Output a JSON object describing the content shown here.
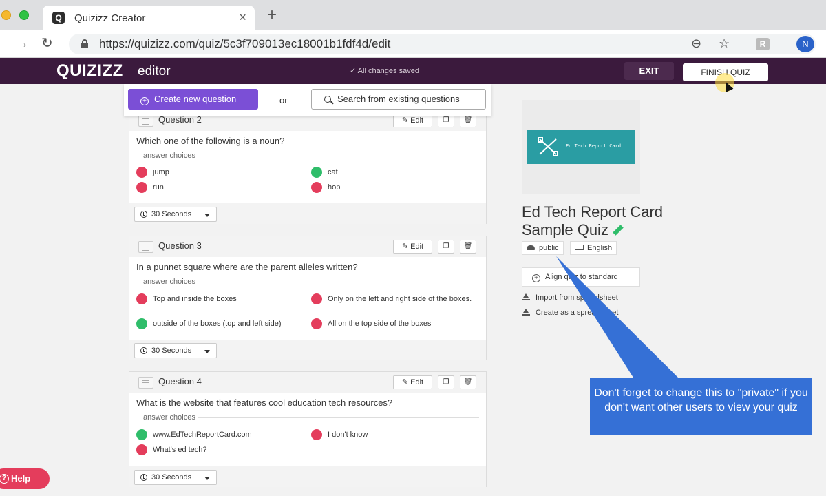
{
  "browser": {
    "tab_title": "Quizizz Creator",
    "tab_close": "×",
    "new_tab": "+",
    "url": "https://quizizz.com/quiz/5c3f709013ec18001b1fdf4d/edit",
    "back_glyph": "→",
    "reload_glyph": "↻",
    "zoom_glyph": "⊖",
    "star_glyph": "☆",
    "extension_label": "R",
    "avatar_initial": "N",
    "favicon_letter": "Q"
  },
  "header": {
    "logo": "QUIZIZZ",
    "logo_sub": "editor",
    "save_status": "✓ All changes saved",
    "exit_label": "EXIT",
    "finish_label": "FINISH QUIZ",
    "bg_color": "#3b1a3d"
  },
  "create_bar": {
    "create_label": "Create new question",
    "or_text": "or",
    "search_label": "Search from existing questions",
    "accent_color": "#7b4fd6"
  },
  "questions": [
    {
      "label": "Question 2",
      "text": "Which one of the following is a noun?",
      "answer_label": "answer choices",
      "choices": [
        {
          "text": "jump",
          "correct": false
        },
        {
          "text": "cat",
          "correct": true
        },
        {
          "text": "run",
          "correct": false
        },
        {
          "text": "hop",
          "correct": false
        }
      ],
      "time": "30 Seconds",
      "edit_label": "Edit"
    },
    {
      "label": "Question 3",
      "text": "In a punnet square where are the parent alleles written?",
      "answer_label": "answer choices",
      "choices": [
        {
          "text": "Top and inside the boxes",
          "correct": false
        },
        {
          "text": "Only on the left and right side of the boxes.",
          "correct": false
        },
        {
          "text": "outside of the boxes (top and left side)",
          "correct": true
        },
        {
          "text": "All on the top side of the boxes",
          "correct": false
        }
      ],
      "time": "30 Seconds",
      "edit_label": "Edit"
    },
    {
      "label": "Question 4",
      "text": "What is the website that features cool education tech resources?",
      "answer_label": "answer choices",
      "choices": [
        {
          "text": "www.EdTechReportCard.com",
          "correct": true
        },
        {
          "text": "I don't know",
          "correct": false
        },
        {
          "text": "What's ed tech?",
          "correct": false
        }
      ],
      "time": "30 Seconds",
      "edit_label": "Edit"
    }
  ],
  "quiz_info": {
    "thumbnail_text": "Ed Tech Report Card",
    "title": "Ed Tech Report Card Sample Quiz",
    "visibility": "public",
    "language": "English",
    "align_label": "Align quiz to standard",
    "import_label": "Import from spreadsheet",
    "create_sheet_label": "Create as a spreadsheet"
  },
  "callout": {
    "text": "Don't forget to change this to \"private\" if you don't want other users to view your quiz",
    "color": "#3570d6"
  },
  "help": {
    "label": "Help",
    "icon": "?"
  }
}
